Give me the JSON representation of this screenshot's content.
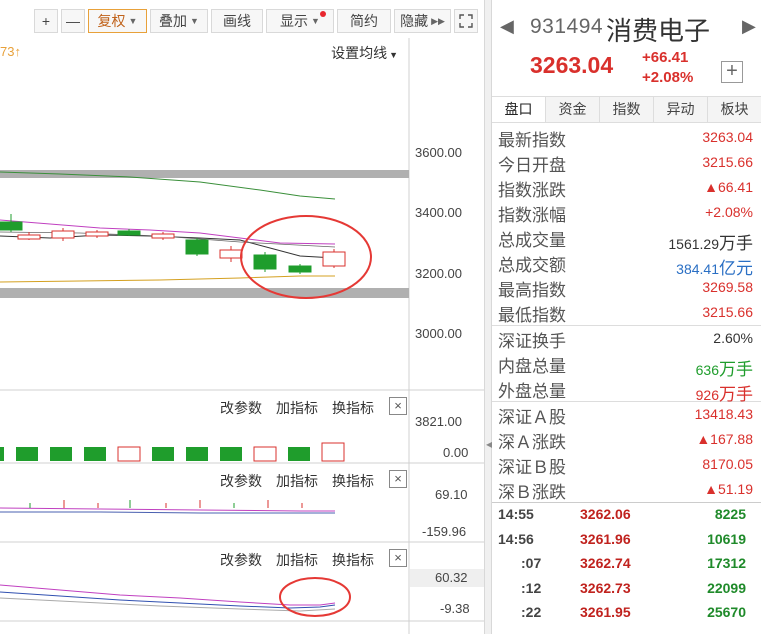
{
  "toolbar": {
    "plus": "+",
    "minus": "—",
    "fuquan": "复权",
    "diejia": "叠加",
    "huaxian": "画线",
    "xianshi": "显示",
    "jianyue": "简约",
    "yincang": "隐藏",
    "expand_icon": "expand-icon"
  },
  "main_chart": {
    "ma_value_fragment": "73↑",
    "ma_setting": "设置均线",
    "price_axis": [
      "3600.00",
      "3400.00",
      "3200.00",
      "3000.00"
    ]
  },
  "sub_panels": [
    {
      "edit": "改参数",
      "add": "加指标",
      "swap": "换指标",
      "close": "×",
      "top_value": "3821.00",
      "bottom_value": "0.00"
    },
    {
      "edit": "改参数",
      "add": "加指标",
      "swap": "换指标",
      "close": "×",
      "top_value": "69.10",
      "bottom_value": "-159.96"
    },
    {
      "edit": "改参数",
      "add": "加指标",
      "swap": "换指标",
      "close": "×",
      "top_value": "60.32",
      "bottom_value": "-9.38"
    }
  ],
  "stock": {
    "code": "931494",
    "name": "消费电子",
    "price": "3263.04",
    "change": "+66.41",
    "change_pct": "+2.08%",
    "add": "+"
  },
  "tabs": [
    "盘口",
    "资金",
    "指数",
    "异动",
    "板块"
  ],
  "stats": [
    {
      "label": "最新指数",
      "value": "3263.04",
      "color": "red"
    },
    {
      "label": "今日开盘",
      "value": "3215.66",
      "color": "red"
    },
    {
      "label": "指数涨跌",
      "value": "▲66.41",
      "color": "red"
    },
    {
      "label": "指数涨幅",
      "value": "+2.08%",
      "color": "red"
    },
    {
      "label": "总成交量",
      "value": "1561.29",
      "unit": "万手",
      "color": "plain"
    },
    {
      "label": "总成交额",
      "value": "384.41",
      "unit": "亿元",
      "color": "blue"
    },
    {
      "label": "最高指数",
      "value": "3269.58",
      "color": "red"
    },
    {
      "label": "最低指数",
      "value": "3215.66",
      "color": "red"
    },
    {
      "label": "深证换手",
      "value": "2.60%",
      "color": "plain",
      "sep": true
    },
    {
      "label": "内盘总量",
      "value": "636",
      "unit": "万手",
      "color": "green"
    },
    {
      "label": "外盘总量",
      "value": "926",
      "unit": "万手",
      "color": "red"
    },
    {
      "label": "深证Ａ股",
      "value": "13418.43",
      "color": "red",
      "sep": true
    },
    {
      "label": "深Ａ涨跌",
      "value": "▲167.88",
      "color": "red"
    },
    {
      "label": "深证Ｂ股",
      "value": "8170.05",
      "color": "red"
    },
    {
      "label": "深Ｂ涨跌",
      "value": "▲51.19",
      "color": "red"
    }
  ],
  "ticks": [
    {
      "time": "14:55",
      "price": "3262.06",
      "volume": "8225",
      "sub": false
    },
    {
      "time": "14:56",
      "price": "3261.96",
      "volume": "10619",
      "sub": false
    },
    {
      "time": ":07",
      "price": "3262.74",
      "volume": "17312",
      "sub": true
    },
    {
      "time": ":12",
      "price": "3262.73",
      "volume": "22099",
      "sub": true
    },
    {
      "time": ":22",
      "price": "3261.95",
      "volume": "25670",
      "sub": true
    }
  ],
  "colors": {
    "up": "#d9302c",
    "down": "#1f9d2c",
    "ma5": "#333333",
    "ma10": "#c040c0",
    "ma20": "#3a8f3a",
    "ma60": "#d4a020",
    "highlight_circle": "#e53935"
  }
}
